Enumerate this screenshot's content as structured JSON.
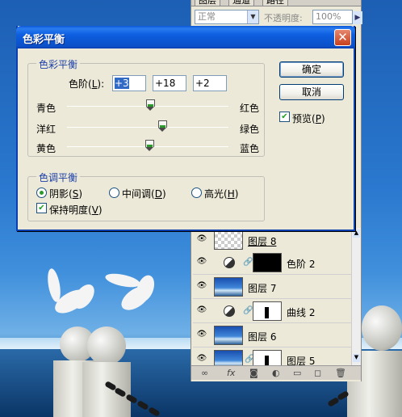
{
  "panel": {
    "tabs": [
      "图层",
      "通道",
      "路径"
    ],
    "blend_mode": "正常",
    "opacity_label": "不透明度:",
    "opacity_value": "100%",
    "layers": [
      {
        "name": "图层 8",
        "type": "transparent"
      },
      {
        "name": "色阶 2",
        "type": "adjustment"
      },
      {
        "name": "图层 7",
        "type": "photo"
      },
      {
        "name": "曲线 2",
        "type": "adjustment"
      },
      {
        "name": "图层 6",
        "type": "photo"
      },
      {
        "name": "图层 5",
        "type": "photo-mask"
      }
    ],
    "footer_icons": [
      "link-icon",
      "fx-icon",
      "mask-icon",
      "adjustment-icon",
      "folder-icon",
      "new-layer-icon",
      "trash-icon"
    ]
  },
  "dialog": {
    "title": "色彩平衡",
    "close": "✕",
    "balance_group": {
      "legend": "色彩平衡",
      "levels_label": "色阶",
      "levels_key": "L",
      "values": [
        "+3",
        "+18",
        "+2"
      ],
      "sliders": [
        {
          "left": "青色",
          "right": "红色",
          "value": 3
        },
        {
          "left": "洋红",
          "right": "绿色",
          "value": 18
        },
        {
          "left": "黄色",
          "right": "蓝色",
          "value": 2
        }
      ]
    },
    "tone_group": {
      "legend": "色调平衡",
      "shadows": "阴影",
      "shadows_key": "S",
      "midtones": "中间调",
      "midtones_key": "D",
      "highlights": "高光",
      "highlights_key": "H",
      "selected": "shadows",
      "preserve": "保持明度",
      "preserve_key": "V",
      "preserve_checked": true
    },
    "ok": "确定",
    "cancel": "取消",
    "preview": "预览",
    "preview_key": "P",
    "preview_checked": true
  }
}
